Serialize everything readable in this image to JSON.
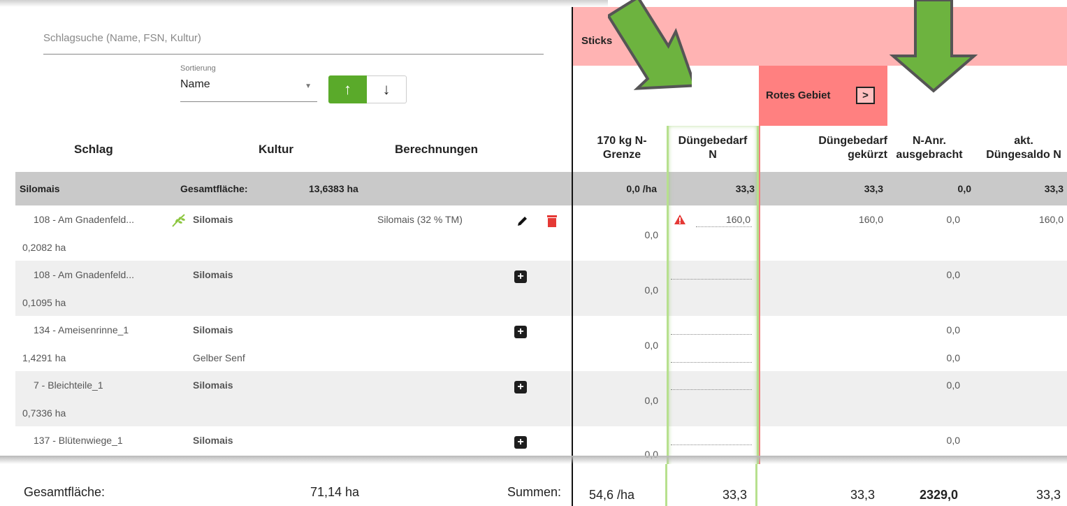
{
  "search": {
    "placeholder": "Schlagsuche (Name, FSN, Kultur)"
  },
  "sort": {
    "label": "Sortierung",
    "value": "Name",
    "asc_icon": "arrow-up-icon",
    "desc_icon": "arrow-down-icon"
  },
  "columns": {
    "schlag": "Schlag",
    "kultur": "Kultur",
    "berechnungen": "Berechnungen"
  },
  "group": {
    "name": "Silomais",
    "area_label": "Gesamtfläche:",
    "area_value": "13,6383 ha",
    "grenze": "0,0 /ha",
    "bedarf": "33,3",
    "gekuerzt": "33,3",
    "anr": "0,0",
    "saldo": "33,3"
  },
  "rows": [
    {
      "name": "108 - Am Gnadenfeld...",
      "area": "0,2082 ha",
      "kultur": "Silomais",
      "kultur2": "",
      "berechnung": "Silomais (32 % TM)",
      "grenze": "0,0",
      "bedarf": "160,0",
      "gekuerzt": "160,0",
      "anr": "0,0",
      "anr2": "",
      "saldo": "160,0"
    },
    {
      "name": "108 - Am Gnadenfeld...",
      "area": "0,1095 ha",
      "kultur": "Silomais",
      "kultur2": "",
      "berechnung": "",
      "grenze": "0,0",
      "bedarf": "",
      "gekuerzt": "",
      "anr": "0,0",
      "anr2": "",
      "saldo": ""
    },
    {
      "name": "134 - Ameisenrinne_1",
      "area": "1,4291 ha",
      "kultur": "Silomais",
      "kultur2": "Gelber Senf",
      "berechnung": "",
      "grenze": "0,0",
      "bedarf": "",
      "gekuerzt": "",
      "anr": "0,0",
      "anr2": "0,0",
      "saldo": ""
    },
    {
      "name": "7 - Bleichteile_1",
      "area": "0,7336 ha",
      "kultur": "Silomais",
      "kultur2": "",
      "berechnung": "",
      "grenze": "0,0",
      "bedarf": "",
      "gekuerzt": "",
      "anr": "0,0",
      "anr2": "",
      "saldo": ""
    },
    {
      "name": "137 - Blütenwiege_1",
      "area": "",
      "kultur": "Silomais",
      "kultur2": "",
      "berechnung": "",
      "grenze": "0,0",
      "bedarf": "",
      "gekuerzt": "",
      "anr": "0,0",
      "anr2": "",
      "saldo": ""
    }
  ],
  "right": {
    "banner": "Sticks      g N/ha)",
    "rotes_label": "Rotes Gebiet",
    "rotes_chevron": ">",
    "h_grenze": "170 kg N-\nGrenze",
    "h_bedarf": "Düngebedarf\nN",
    "h_gekuerzt": "Düngebedarf\ngekürzt",
    "h_anr": "N-Anr.\nausgebracht",
    "h_saldo": "akt.\nDüngesaldo N"
  },
  "footer": {
    "area_label": "Gesamtfläche:",
    "area_value": "71,14 ha",
    "sum_label": "Summen:",
    "grenze": "54,6 /ha",
    "bedarf": "33,3",
    "gekuerzt": "33,3",
    "anr": "2329,0",
    "saldo": "33,3"
  },
  "colors": {
    "accent_green": "#5aaa2a",
    "red_banner": "#ffb3b3",
    "red_area": "#ff8080",
    "arrow_green": "#6db33f",
    "delete_red": "#e53935"
  }
}
